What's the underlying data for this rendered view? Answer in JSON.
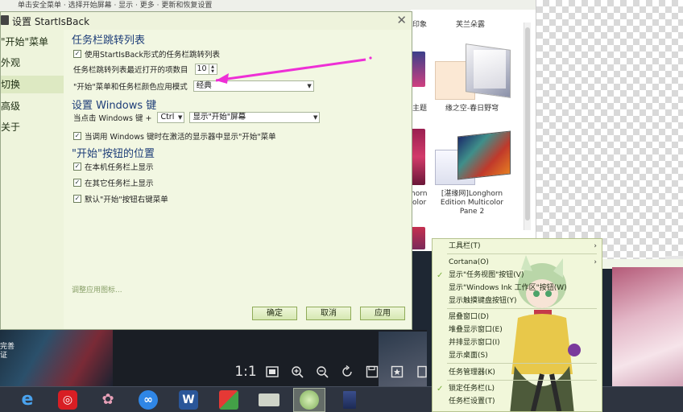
{
  "top_strip": {
    "text": "单击安全菜单 · 选择开始屏幕 · 显示 · 更多 · 更新和恢复设置"
  },
  "gallery": {
    "header_left": "印象",
    "header_right": "芙兰朵露",
    "left_caption_1": "主题",
    "left_caption_2a": "horn",
    "left_caption_2b": "olor",
    "theme_1": "缘之空-春日野穹",
    "theme_2": "[湛缘网]Longhorn Edition Multicolor Pane 2"
  },
  "dialog": {
    "title": "设置 StartIsBack",
    "close": "✕",
    "nav": [
      {
        "label": "\"开始\"菜单",
        "selected": false
      },
      {
        "label": "外观",
        "selected": false
      },
      {
        "label": "切换",
        "selected": true
      },
      {
        "label": "高级",
        "selected": false
      },
      {
        "label": "关于",
        "selected": false
      }
    ],
    "sections": {
      "jumplist": {
        "heading": "任务栏跳转列表",
        "use_sib_jumplist": "使用StartIsBack形式的任务栏跳转列表",
        "use_sib_jumplist_checked": true,
        "recent_items_label": "任务栏跳转列表最近打开的项数目",
        "recent_items_value": "10",
        "color_mode_label": "\"开始\"菜单和任务栏颜色应用模式",
        "color_mode_value": "经典"
      },
      "winkey": {
        "heading": "设置 Windows 键",
        "click_label": "当点击 Windows 键 +",
        "modifier_value": "Ctrl",
        "action_value": "显示\"开始\"屏幕",
        "active_display_label": "当调用 Windows 键时在激活的显示器中显示\"开始\"菜单",
        "active_display_checked": true
      },
      "start_button": {
        "heading": "\"开始\"按钮的位置",
        "show_on_main": "在本机任务栏上显示",
        "show_on_main_checked": true,
        "show_on_others": "在其它任务栏上显示",
        "show_on_others_checked": true,
        "default_right_click": "默认\"开始\"按钮右键菜单",
        "default_right_click_checked": true
      }
    },
    "adjust_icons_link": "调整应用图标...",
    "buttons": {
      "ok": "确定",
      "cancel": "取消",
      "apply": "应用"
    }
  },
  "context_menu": {
    "items": [
      {
        "label": "工具栏(T)",
        "submenu": true,
        "checked": false
      },
      {
        "label": "Cortana(O)",
        "submenu": true,
        "checked": false
      },
      {
        "label": "显示\"任务视图\"按钮(V)",
        "submenu": false,
        "checked": true
      },
      {
        "label": "显示\"Windows Ink 工作区\"按钮(W)",
        "submenu": false,
        "checked": false
      },
      {
        "label": "显示触摸键盘按钮(Y)",
        "submenu": false,
        "checked": false
      },
      {
        "label": "层叠窗口(D)",
        "submenu": false,
        "checked": false
      },
      {
        "label": "堆叠显示窗口(E)",
        "submenu": false,
        "checked": false
      },
      {
        "label": "并排显示窗口(I)",
        "submenu": false,
        "checked": false
      },
      {
        "label": "显示桌面(S)",
        "submenu": false,
        "checked": false
      },
      {
        "label": "任务管理器(K)",
        "submenu": false,
        "checked": false
      },
      {
        "label": "锁定任务栏(L)",
        "submenu": false,
        "checked": true
      },
      {
        "label": "任务栏设置(T)",
        "submenu": false,
        "checked": false
      }
    ],
    "submenu_glyph": "›",
    "check_glyph": "✓"
  },
  "viewer": {
    "left_text_1": "完善",
    "left_text_2": "证",
    "ratio_label": "1:1"
  },
  "icons": {
    "taskbar": [
      "ie-icon",
      "netease-music-icon",
      "chat-bird-icon",
      "baidu-cloud-icon",
      "word-icon",
      "image-app-icon",
      "folder-icon",
      "photo-viewer-icon",
      "startisback-icon"
    ]
  },
  "colors": {
    "dialog_bg": "#f2f7e2",
    "section_heading": "#1d3d78",
    "annotation_arrow": "#ee2fd6",
    "taskbar_bg": "#2e3440"
  }
}
